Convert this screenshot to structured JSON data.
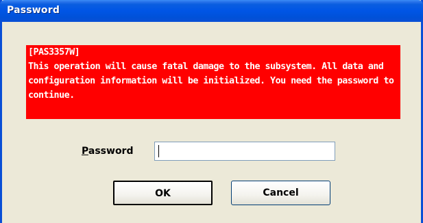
{
  "window": {
    "title": "Password"
  },
  "warning": {
    "code": "[PAS3357W]",
    "message": "This operation will cause fatal damage to the subsystem. All data and configuration information will be initialized. You need the password to continue.",
    "background_color": "#ff0000",
    "text_color": "#ffffff"
  },
  "form": {
    "password_label_accesskey": "P",
    "password_label_rest": "assword",
    "password_value": ""
  },
  "buttons": {
    "ok_label": "OK",
    "cancel_label": "Cancel"
  },
  "colors": {
    "titlebar": "#0055e5",
    "dialog_bg": "#ece9d8"
  }
}
